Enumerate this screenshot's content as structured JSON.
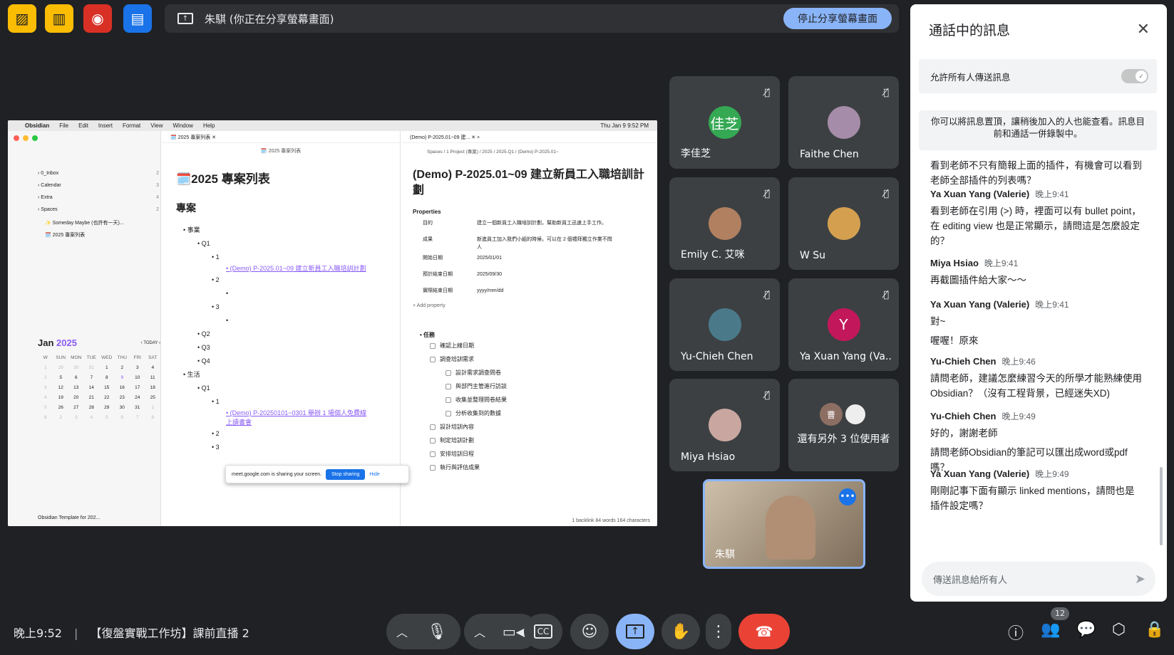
{
  "toolbar": {
    "share_status": "朱騏 (你正在分享螢幕畫面)",
    "stop_share_label": "停止分享螢幕畫面"
  },
  "participants": [
    {
      "name": "李佳芝",
      "avatar_text": "佳芝",
      "avatar_color": "#34a853"
    },
    {
      "name": "Faithe Chen",
      "avatar_text": "",
      "avatar_color": "#a58ca8"
    },
    {
      "name": "Emily C. 艾咪",
      "avatar_text": "",
      "avatar_color": "#b08060"
    },
    {
      "name": "W Su",
      "avatar_text": "",
      "avatar_color": "#d4a050"
    },
    {
      "name": "Yu-Chieh Chen",
      "avatar_text": "",
      "avatar_color": "#4a7a8a"
    },
    {
      "name": "Ya Xuan Yang (Va...",
      "avatar_text": "Y",
      "avatar_color": "#c2185b"
    },
    {
      "name": "Miya Hsiao",
      "avatar_text": "",
      "avatar_color": "#c9a7a0"
    },
    {
      "name": "還有另外 3 位使用者",
      "avatar_text": "曹",
      "avatar_color": "#8d6e63"
    }
  ],
  "self_tile": {
    "name": "朱騏"
  },
  "screen": {
    "menu": [
      "Obsidian",
      "File",
      "Edit",
      "Insert",
      "Format",
      "View",
      "Window",
      "Help"
    ],
    "clock": "Thu Jan 9  9:52 PM",
    "tab1": "2025 專案列表",
    "tab2": "(Demo) P-2025.01~09 建...",
    "folders": [
      {
        "name": "0_Inbox",
        "count": "2"
      },
      {
        "name": "Calendar",
        "count": "3"
      },
      {
        "name": "Extra",
        "count": "4"
      },
      {
        "name": "Spaces",
        "count": "2"
      }
    ],
    "files": [
      "✨ Someday Maybe (也許有一天)...",
      "🗓️ 2025 專案列表"
    ],
    "calendar": {
      "month": "Jan",
      "year": "2025",
      "today_label": "TODAY",
      "days": [
        "W",
        "SUN",
        "MON",
        "TUE",
        "WED",
        "THU",
        "FRI",
        "SAT"
      ],
      "weeks": [
        [
          "1",
          "29",
          "30",
          "31",
          "1",
          "2",
          "3",
          "4"
        ],
        [
          "2",
          "5",
          "6",
          "7",
          "8",
          "9",
          "10",
          "11"
        ],
        [
          "3",
          "12",
          "13",
          "14",
          "15",
          "16",
          "17",
          "18"
        ],
        [
          "4",
          "19",
          "20",
          "21",
          "22",
          "23",
          "24",
          "25"
        ],
        [
          "5",
          "26",
          "27",
          "28",
          "29",
          "30",
          "31",
          "1"
        ],
        [
          "6",
          "2",
          "3",
          "4",
          "5",
          "6",
          "7",
          "8"
        ]
      ]
    },
    "vault": "Obsidian Template for 202...",
    "note1": {
      "breadcrumb": "🗓️ 2025 專案列表",
      "title": "2025 專案列表",
      "h2": "專案",
      "items": [
        "事業",
        "Q1",
        "1",
        "(Demo) P-2025.01~09 建立新員工入職培訓計劃",
        "2",
        "3",
        "Q2",
        "Q3",
        "Q4",
        "生活",
        "Q1",
        "1",
        "(Demo) P-20250101~0301 舉辦 1 場個人免費線上讀書會",
        "2",
        "3"
      ]
    },
    "note2": {
      "breadcrumb": "Spaces / 1 Project (專案) / 2025 / 2025.Q1 / (Demo) P-2025.01~",
      "title": "(Demo) P-2025.01~09 建立新員工入職培訓計劃",
      "properties_label": "Properties",
      "props": [
        {
          "k": "目的",
          "v": "建立一個新員工入職培訓計劃，幫助新員工迅速上手工作。"
        },
        {
          "k": "成果",
          "v": "新進員工加入我們小組的時候，可以在 2 個禮拜獨立作業不問人"
        },
        {
          "k": "開始日期",
          "v": "2025/01/01"
        },
        {
          "k": "預計結束日期",
          "v": "2025/09/30"
        },
        {
          "k": "實際結束日期",
          "v": "yyyy/mm/dd"
        }
      ],
      "add_property": "+ Add property",
      "tasks_label": "任務",
      "tasks": [
        "確認上線日期",
        "調查培訓需求",
        "設計需求調查問卷",
        "與部門主管進行訪談",
        "收集並整理問卷結果",
        "分析收集到的數據",
        "設計培訓內容",
        "制定培訓計劃",
        "安排培訓日程",
        "執行與評估成果"
      ],
      "status": "1 backlink   84 words  164 characters"
    },
    "share_notice": "meet.google.com is sharing your screen.",
    "stop_sharing": "Stop sharing",
    "hide": "Hide"
  },
  "chat": {
    "title": "通話中的訊息",
    "allow_label": "允許所有人傳送訊息",
    "notice": "你可以將訊息置頂，讓稍後加入的人也能查看。訊息目前和通話一併錄製中。",
    "partial": "看到老師不只有簡報上面的插件，有機會可以看到老師全部插件的列表嗎？",
    "messages": [
      {
        "name": "Ya Xuan Yang (Valerie)",
        "time": "晚上9:41",
        "text": "看到老師在引用 (>) 時，裡面可以有 bullet point，在 editing view 也是正常顯示，請問這是怎麼設定的？"
      },
      {
        "name": "Miya Hsiao",
        "time": "晚上9:41",
        "text": "再截圖插件給大家～～"
      },
      {
        "name": "Ya Xuan Yang (Valerie)",
        "time": "晚上9:41",
        "text": "對~",
        "text2": "喔喔！原來"
      },
      {
        "name": "Yu-Chieh Chen",
        "time": "晚上9:46",
        "text": "請問老師，建議怎麼練習今天的所學才能熟練使用Obsidian？（沒有工程背景，已經迷失XD)"
      },
      {
        "name": "Yu-Chieh Chen",
        "time": "晚上9:49",
        "text": "好的，謝謝老師",
        "text2": "請問老師Obsidian的筆記可以匯出成word或pdf嗎？"
      },
      {
        "name": "Ya Xuan Yang (Valerie)",
        "time": "晚上9:49",
        "text": "剛剛記事下面有顯示 linked mentions，請問也是插件設定嗎？"
      }
    ],
    "input_placeholder": "傳送訊息給所有人"
  },
  "bottom": {
    "time": "晚上9:52",
    "meeting_title": "【復盤實戰工作坊】課前直播 2",
    "participant_count": "12"
  },
  "colors": {
    "accent": "#8ab4f8",
    "hangup": "#ea4335",
    "present_active": "#8ab4f8"
  }
}
